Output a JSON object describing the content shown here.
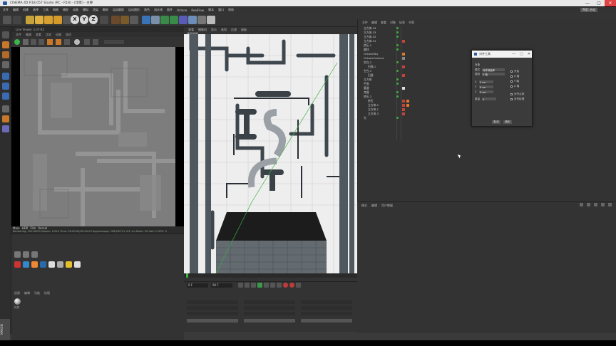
{
  "window": {
    "title": "CINEMA 4D R18.057 Studio (RC - R18) - [场景] - 主要"
  },
  "titlebar_controls": [
    "—",
    "▢",
    "✕"
  ],
  "menubar": {
    "items": [
      "文件",
      "编辑",
      "创建",
      "选择",
      "工具",
      "网格",
      "捕捉",
      "动画",
      "模拟",
      "渲染",
      "雕刻",
      "运动跟踪",
      "运动图形",
      "角色",
      "流水线",
      "插件",
      "Octane",
      "RealFlow",
      "脚本",
      "窗口",
      "帮助"
    ],
    "layout_label": "界面: 启动"
  },
  "toolbar": {
    "axis_letters": [
      "X",
      "Y",
      "Z"
    ]
  },
  "picture_viewer": {
    "tab": "Live Viewer 3.07-R2",
    "menu": [
      "文件",
      "编辑",
      "查看",
      "比较",
      "动画",
      "选项"
    ],
    "status_tabs": [
      "Main",
      "HDR",
      "Film",
      "Kernel"
    ],
    "status_line": "Rendering: 100.000%  Ms/sec: 2.025  Time: 00:00:03/00:00:03  Spp/maxspp: 256/256  Tri: 0/1.1m  Mesh: 30  Hair: 0  GPU: 0"
  },
  "material_manager": {
    "menu": [
      "创建",
      "编辑",
      "功能",
      "纹理"
    ],
    "material_name": "材质"
  },
  "sidebar_brand": "MAXON",
  "viewport": {
    "menu": [
      "查看",
      "摄像机",
      "显示",
      "选项",
      "过滤",
      "面板"
    ],
    "label": "透视视图",
    "ruler_ticks": [
      "0",
      "10",
      "20",
      "30",
      "40",
      "50",
      "60",
      "70",
      "80",
      "90"
    ],
    "timeline_frame": "0 F",
    "timeline_end": "90 F"
  },
  "object_manager": {
    "menu": [
      "文件",
      "编辑",
      "查看",
      "对象",
      "标签",
      "书签"
    ],
    "objects": [
      {
        "name": "立方体.34"
      },
      {
        "name": "立方体.33"
      },
      {
        "name": "立方体.32"
      },
      {
        "name": "立方体.31"
      },
      {
        "name": "挤压.1"
      },
      {
        "name": "圆柱"
      },
      {
        "name": "OctaneSky"
      },
      {
        "name": "OctaneCamera"
      },
      {
        "name": "空白.2"
      },
      {
        "name": "扫描.1"
      },
      {
        "name": "空白.1"
      },
      {
        "name": "扫描"
      },
      {
        "name": "立方体"
      },
      {
        "name": "平面"
      },
      {
        "name": "管道"
      },
      {
        "name": "克隆"
      },
      {
        "name": "挤压.2"
      },
      {
        "name": "挤压"
      },
      {
        "name": "立方体.2"
      },
      {
        "name": "立方体.1"
      },
      {
        "name": "立方体.3"
      },
      {
        "name": "光"
      }
    ]
  },
  "dialog": {
    "title": "对齐工具",
    "section": "对象",
    "fields": [
      {
        "label": "模式",
        "value": "对齐到选择"
      },
      {
        "label": "轴向",
        "value": "X 轴"
      },
      {
        "label": "X",
        "value": "0 cm"
      },
      {
        "label": "Y",
        "value": "0 cm"
      },
      {
        "label": "Z",
        "value": "0 cm"
      },
      {
        "label": "数量",
        "value": "0"
      }
    ],
    "checks": [
      "开启",
      "X 轴",
      "Y 轴",
      "Z 轴",
      "对齐点到",
      "对齐纹理"
    ],
    "buttons": [
      "取消",
      "确定"
    ]
  },
  "attributes": {
    "menu": [
      "模式",
      "编辑",
      "用户数据"
    ]
  }
}
